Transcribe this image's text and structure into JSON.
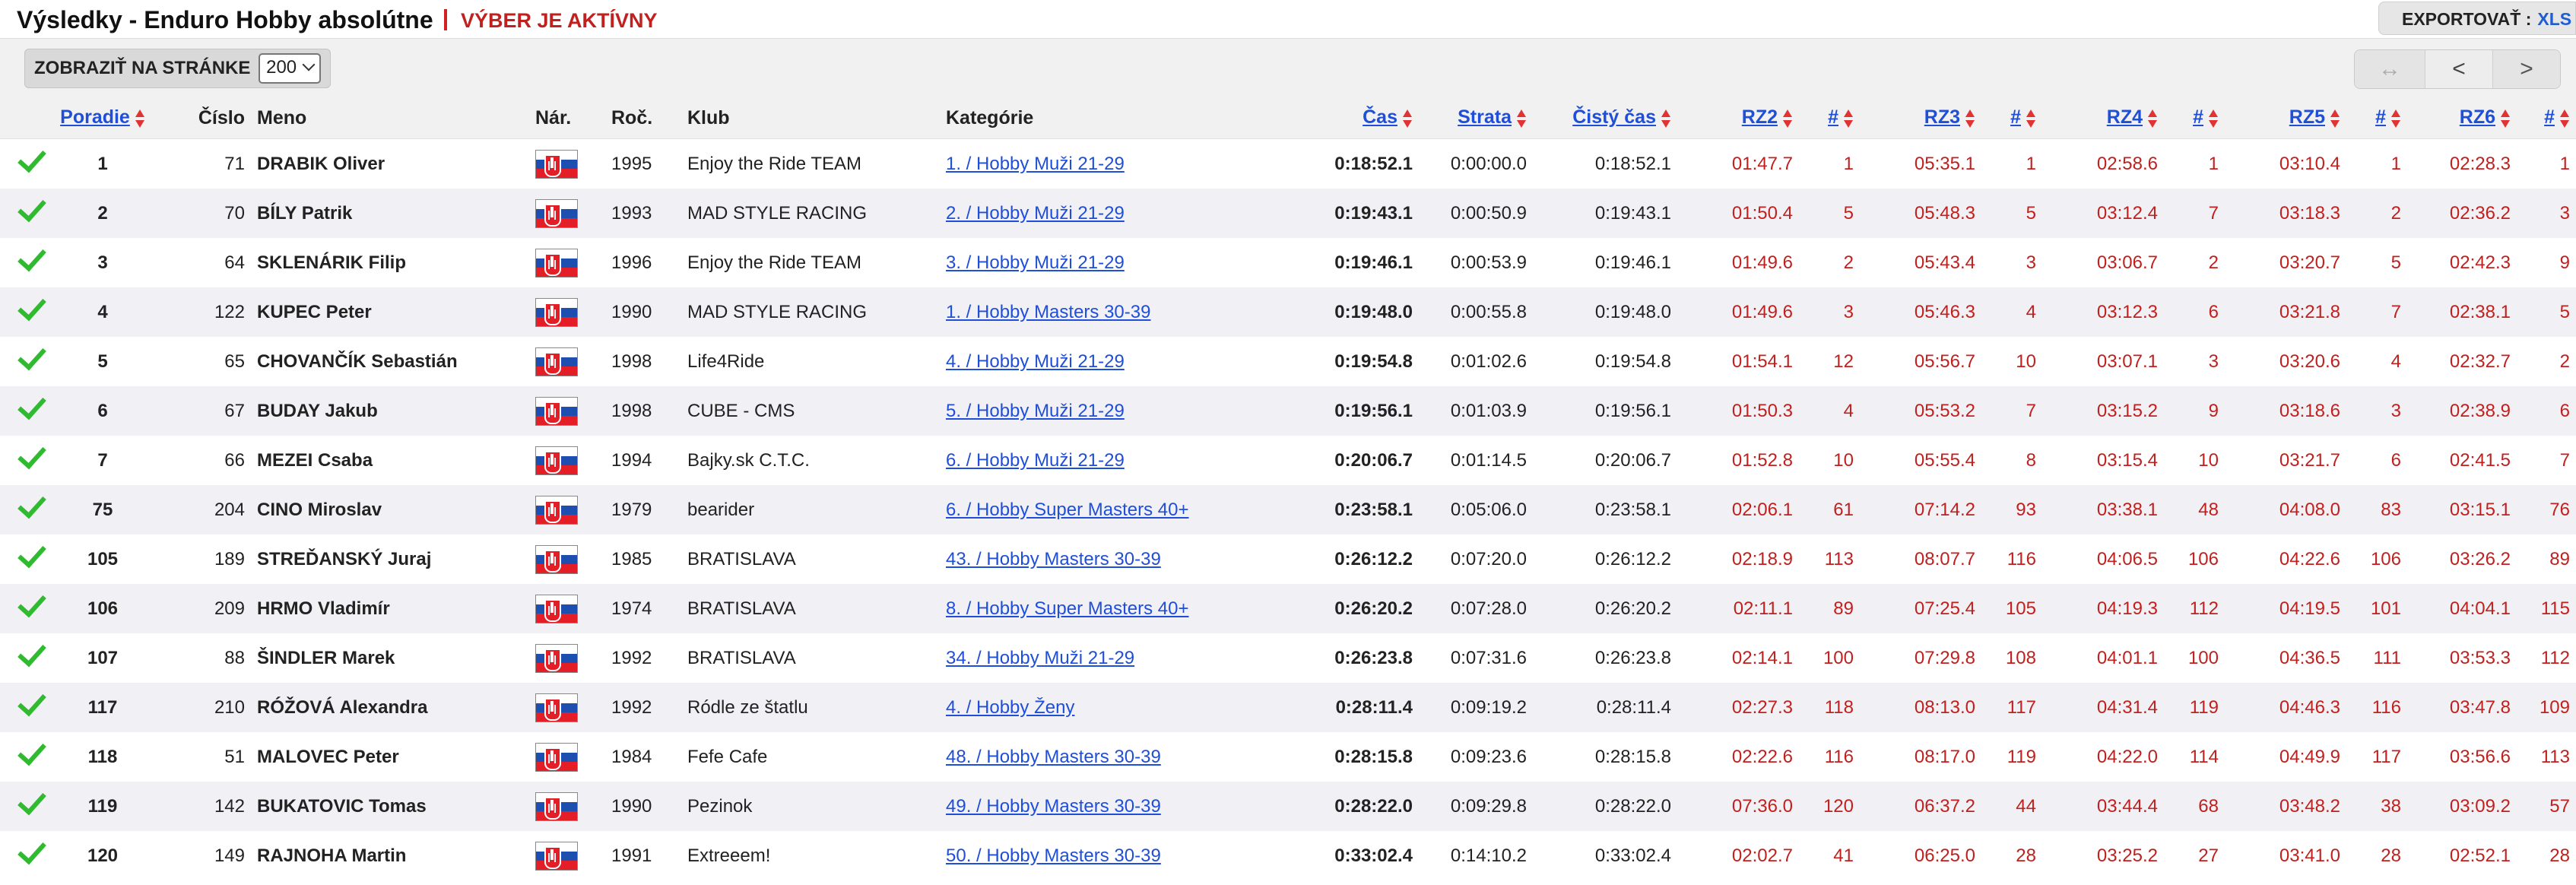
{
  "header": {
    "title": "Výsledky - Enduro Hobby absolútne",
    "selection_warning": "VÝBER JE AKTÍVNY",
    "export_label": "EXPORTOVAŤ :",
    "export_xls": "XLS"
  },
  "toolbar": {
    "per_page_label": "ZOBRAZIŤ NA STRÁNKE",
    "per_page_value": "200",
    "pager": {
      "swap": "↔",
      "prev": "<",
      "next": ">"
    }
  },
  "columns": [
    "Poradie",
    "Číslo",
    "Meno",
    "Nár.",
    "Roč.",
    "Klub",
    "Kategórie",
    "Čas",
    "Strata",
    "Čistý čas",
    "RZ2",
    "#",
    "RZ3",
    "#",
    "RZ4",
    "#",
    "RZ5",
    "#",
    "RZ6",
    "#"
  ],
  "rows": [
    {
      "pos": "1",
      "num": "71",
      "name": "DRABIK Oliver",
      "year": "1995",
      "club": "Enjoy the Ride TEAM",
      "cat": "1. /  Hobby Muži 21-29",
      "time": "0:18:52.1",
      "loss": "0:00:00.0",
      "net": "0:18:52.1",
      "rz2": "01:47.7",
      "rz2r": "1",
      "rz3": "05:35.1",
      "rz3r": "1",
      "rz4": "02:58.6",
      "rz4r": "1",
      "rz5": "03:10.4",
      "rz5r": "1",
      "rz6": "02:28.3",
      "rz6r": "1"
    },
    {
      "pos": "2",
      "num": "70",
      "name": "BÍLY Patrik",
      "year": "1993",
      "club": "MAD STYLE RACING",
      "cat": "2. /  Hobby Muži 21-29",
      "time": "0:19:43.1",
      "loss": "0:00:50.9",
      "net": "0:19:43.1",
      "rz2": "01:50.4",
      "rz2r": "5",
      "rz3": "05:48.3",
      "rz3r": "5",
      "rz4": "03:12.4",
      "rz4r": "7",
      "rz5": "03:18.3",
      "rz5r": "2",
      "rz6": "02:36.2",
      "rz6r": "3"
    },
    {
      "pos": "3",
      "num": "64",
      "name": "SKLENÁRIK Filip",
      "year": "1996",
      "club": "Enjoy the Ride TEAM",
      "cat": "3. /  Hobby Muži 21-29",
      "time": "0:19:46.1",
      "loss": "0:00:53.9",
      "net": "0:19:46.1",
      "rz2": "01:49.6",
      "rz2r": "2",
      "rz3": "05:43.4",
      "rz3r": "3",
      "rz4": "03:06.7",
      "rz4r": "2",
      "rz5": "03:20.7",
      "rz5r": "5",
      "rz6": "02:42.3",
      "rz6r": "9"
    },
    {
      "pos": "4",
      "num": "122",
      "name": "KUPEC Peter",
      "year": "1990",
      "club": "MAD STYLE RACING",
      "cat": "1. /  Hobby Masters 30-39",
      "time": "0:19:48.0",
      "loss": "0:00:55.8",
      "net": "0:19:48.0",
      "rz2": "01:49.6",
      "rz2r": "3",
      "rz3": "05:46.3",
      "rz3r": "4",
      "rz4": "03:12.3",
      "rz4r": "6",
      "rz5": "03:21.8",
      "rz5r": "7",
      "rz6": "02:38.1",
      "rz6r": "5"
    },
    {
      "pos": "5",
      "num": "65",
      "name": "CHOVANČÍK Sebastián",
      "year": "1998",
      "club": "Life4Ride",
      "cat": "4. /  Hobby Muži 21-29",
      "time": "0:19:54.8",
      "loss": "0:01:02.6",
      "net": "0:19:54.8",
      "rz2": "01:54.1",
      "rz2r": "12",
      "rz3": "05:56.7",
      "rz3r": "10",
      "rz4": "03:07.1",
      "rz4r": "3",
      "rz5": "03:20.6",
      "rz5r": "4",
      "rz6": "02:32.7",
      "rz6r": "2"
    },
    {
      "pos": "6",
      "num": "67",
      "name": "BUDAY Jakub",
      "year": "1998",
      "club": "CUBE - CMS",
      "cat": "5. /  Hobby Muži 21-29",
      "time": "0:19:56.1",
      "loss": "0:01:03.9",
      "net": "0:19:56.1",
      "rz2": "01:50.3",
      "rz2r": "4",
      "rz3": "05:53.2",
      "rz3r": "7",
      "rz4": "03:15.2",
      "rz4r": "9",
      "rz5": "03:18.6",
      "rz5r": "3",
      "rz6": "02:38.9",
      "rz6r": "6"
    },
    {
      "pos": "7",
      "num": "66",
      "name": "MEZEI Csaba",
      "year": "1994",
      "club": "Bajky.sk C.T.C.",
      "cat": "6. /  Hobby Muži 21-29",
      "time": "0:20:06.7",
      "loss": "0:01:14.5",
      "net": "0:20:06.7",
      "rz2": "01:52.8",
      "rz2r": "10",
      "rz3": "05:55.4",
      "rz3r": "8",
      "rz4": "03:15.4",
      "rz4r": "10",
      "rz5": "03:21.7",
      "rz5r": "6",
      "rz6": "02:41.5",
      "rz6r": "7"
    },
    {
      "pos": "75",
      "num": "204",
      "name": "CINO Miroslav",
      "year": "1979",
      "club": "bearider",
      "cat": "6. /  Hobby Super Masters 40+",
      "time": "0:23:58.1",
      "loss": "0:05:06.0",
      "net": "0:23:58.1",
      "rz2": "02:06.1",
      "rz2r": "61",
      "rz3": "07:14.2",
      "rz3r": "93",
      "rz4": "03:38.1",
      "rz4r": "48",
      "rz5": "04:08.0",
      "rz5r": "83",
      "rz6": "03:15.1",
      "rz6r": "76"
    },
    {
      "pos": "105",
      "num": "189",
      "name": "STREĎANSKÝ Juraj",
      "year": "1985",
      "club": "BRATISLAVA",
      "cat": "43. /  Hobby Masters 30-39",
      "time": "0:26:12.2",
      "loss": "0:07:20.0",
      "net": "0:26:12.2",
      "rz2": "02:18.9",
      "rz2r": "113",
      "rz3": "08:07.7",
      "rz3r": "116",
      "rz4": "04:06.5",
      "rz4r": "106",
      "rz5": "04:22.6",
      "rz5r": "106",
      "rz6": "03:26.2",
      "rz6r": "89"
    },
    {
      "pos": "106",
      "num": "209",
      "name": "HRMO Vladimír",
      "year": "1974",
      "club": "BRATISLAVA",
      "cat": "8. /  Hobby Super Masters 40+",
      "time": "0:26:20.2",
      "loss": "0:07:28.0",
      "net": "0:26:20.2",
      "rz2": "02:11.1",
      "rz2r": "89",
      "rz3": "07:25.4",
      "rz3r": "105",
      "rz4": "04:19.3",
      "rz4r": "112",
      "rz5": "04:19.5",
      "rz5r": "101",
      "rz6": "04:04.1",
      "rz6r": "115"
    },
    {
      "pos": "107",
      "num": "88",
      "name": "ŠINDLER Marek",
      "year": "1992",
      "club": "BRATISLAVA",
      "cat": "34. /  Hobby Muži 21-29",
      "time": "0:26:23.8",
      "loss": "0:07:31.6",
      "net": "0:26:23.8",
      "rz2": "02:14.1",
      "rz2r": "100",
      "rz3": "07:29.8",
      "rz3r": "108",
      "rz4": "04:01.1",
      "rz4r": "100",
      "rz5": "04:36.5",
      "rz5r": "111",
      "rz6": "03:53.3",
      "rz6r": "112"
    },
    {
      "pos": "117",
      "num": "210",
      "name": "RÓŽOVÁ Alexandra",
      "year": "1992",
      "club": "Ródle ze štatlu",
      "cat": "4. /  Hobby Ženy",
      "time": "0:28:11.4",
      "loss": "0:09:19.2",
      "net": "0:28:11.4",
      "rz2": "02:27.3",
      "rz2r": "118",
      "rz3": "08:13.0",
      "rz3r": "117",
      "rz4": "04:31.4",
      "rz4r": "119",
      "rz5": "04:46.3",
      "rz5r": "116",
      "rz6": "03:47.8",
      "rz6r": "109"
    },
    {
      "pos": "118",
      "num": "51",
      "name": "MALOVEC Peter",
      "year": "1984",
      "club": "Fefe Cafe",
      "cat": "48. /  Hobby Masters 30-39",
      "time": "0:28:15.8",
      "loss": "0:09:23.6",
      "net": "0:28:15.8",
      "rz2": "02:22.6",
      "rz2r": "116",
      "rz3": "08:17.0",
      "rz3r": "119",
      "rz4": "04:22.0",
      "rz4r": "114",
      "rz5": "04:49.9",
      "rz5r": "117",
      "rz6": "03:56.6",
      "rz6r": "113"
    },
    {
      "pos": "119",
      "num": "142",
      "name": "BUKATOVIC Tomas",
      "year": "1990",
      "club": "Pezinok",
      "cat": "49. /  Hobby Masters 30-39",
      "time": "0:28:22.0",
      "loss": "0:09:29.8",
      "net": "0:28:22.0",
      "rz2": "07:36.0",
      "rz2r": "120",
      "rz3": "06:37.2",
      "rz3r": "44",
      "rz4": "03:44.4",
      "rz4r": "68",
      "rz5": "03:48.2",
      "rz5r": "38",
      "rz6": "03:09.2",
      "rz6r": "57"
    },
    {
      "pos": "120",
      "num": "149",
      "name": "RAJNOHA Martin",
      "year": "1991",
      "club": "Extreeem!",
      "cat": "50. /  Hobby Masters 30-39",
      "time": "0:33:02.4",
      "loss": "0:14:10.2",
      "net": "0:33:02.4",
      "rz2": "02:02.7",
      "rz2r": "41",
      "rz3": "06:25.0",
      "rz3r": "28",
      "rz4": "03:25.2",
      "rz4r": "27",
      "rz5": "03:41.0",
      "rz5r": "28",
      "rz6": "02:52.1",
      "rz6r": "28"
    }
  ]
}
